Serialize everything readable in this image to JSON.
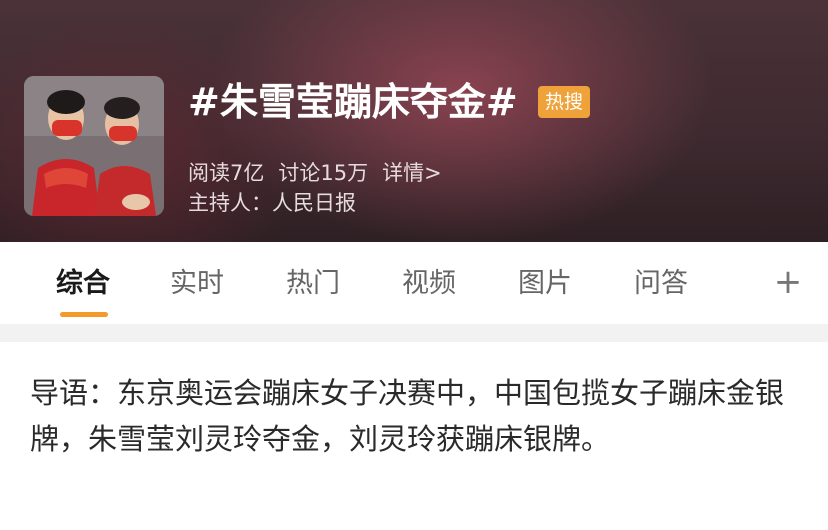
{
  "topic": {
    "title": "#朱雪莹蹦床夺金#",
    "badge": "热搜",
    "reads": "阅读7亿",
    "discussions": "讨论15万",
    "details_link": "详情>",
    "host": "主持人：人民日报"
  },
  "tabs": [
    {
      "label": "综合",
      "active": true
    },
    {
      "label": "实时",
      "active": false
    },
    {
      "label": "热门",
      "active": false
    },
    {
      "label": "视频",
      "active": false
    },
    {
      "label": "图片",
      "active": false
    },
    {
      "label": "问答",
      "active": false
    }
  ],
  "add_tab_glyph": "+",
  "guide": {
    "text": "导语：东京奥运会蹦床女子决赛中，中国包揽女子蹦床金银牌，朱雪莹刘灵玲夺金，刘灵玲获蹦床银牌。"
  },
  "colors": {
    "accent": "#f39a2a",
    "badge": "#f0a23a",
    "header_bg": "#3e2a30"
  },
  "icons": {
    "add_tab": "plus-icon"
  }
}
